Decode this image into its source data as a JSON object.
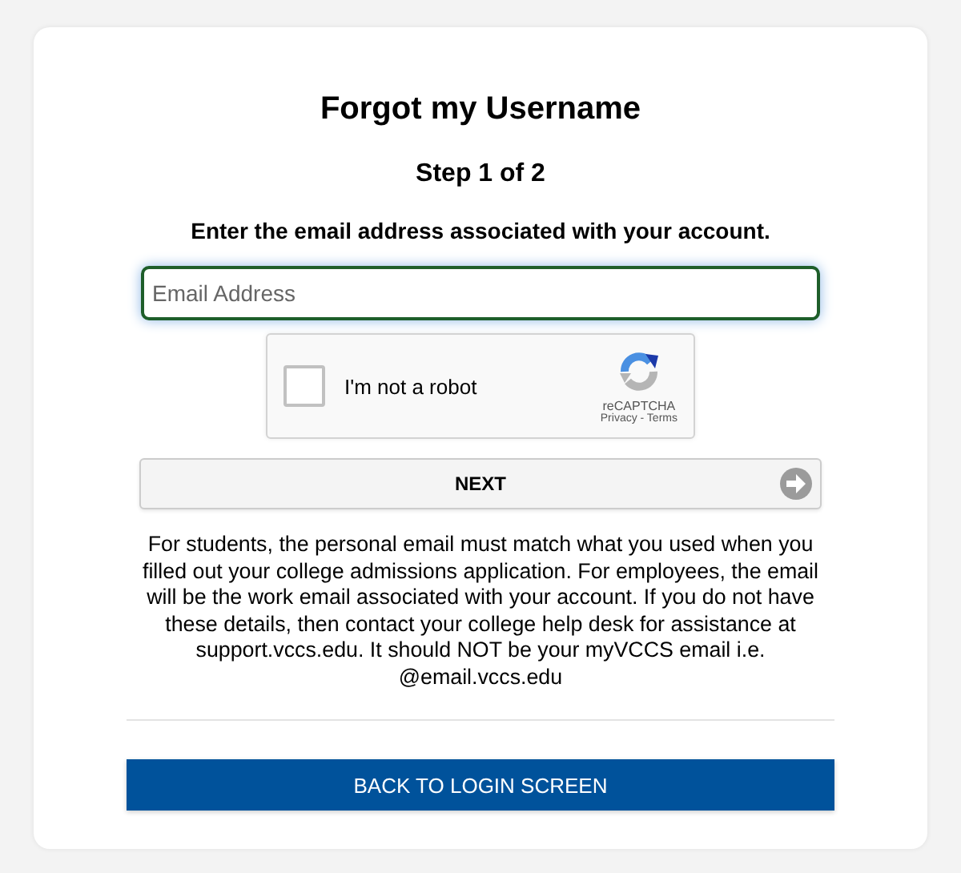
{
  "title": "Forgot my Username",
  "step": "Step 1 of 2",
  "prompt": "Enter the email address associated with your account.",
  "email_field": {
    "placeholder": "Email Address"
  },
  "captcha": {
    "label": "I'm not a robot",
    "checked": false,
    "brand": "reCAPTCHA",
    "links": "Privacy - Terms"
  },
  "next_button": "NEXT",
  "help_text": "For students, the personal email must match what you used when you filled out your college admissions application. For employees, the email will be the work email associated with your account. If you do not have these details, then contact your college help desk for assistance at support.vccs.edu. It should NOT be your myVCCS email i.e. @email.vccs.edu",
  "back_button": "BACK TO LOGIN SCREEN"
}
